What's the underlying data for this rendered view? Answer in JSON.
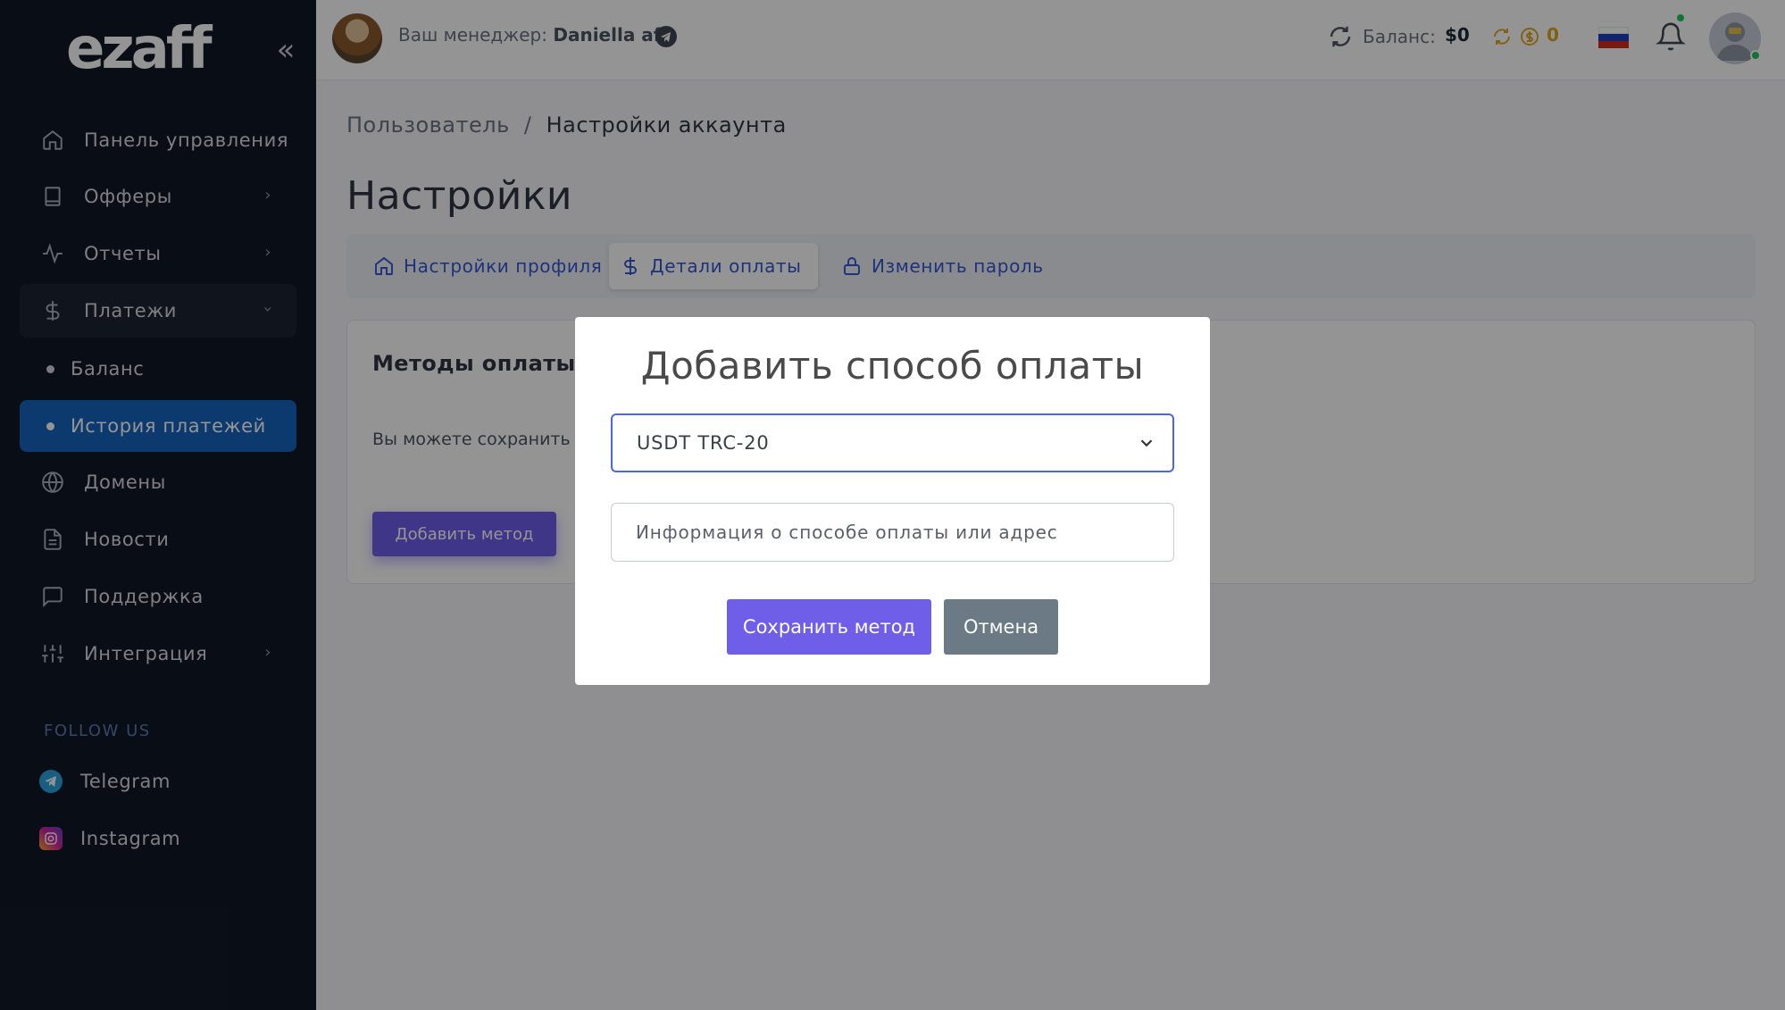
{
  "brand": {
    "logo_text": "ezaff"
  },
  "sidebar": {
    "items": [
      {
        "label": "Панель управления",
        "icon": "home-icon"
      },
      {
        "label": "Офферы",
        "icon": "book-icon"
      },
      {
        "label": "Отчеты",
        "icon": "activity-icon"
      },
      {
        "label": "Платежи",
        "icon": "dollar-icon"
      },
      {
        "label": "Домены",
        "icon": "globe-icon"
      },
      {
        "label": "Новости",
        "icon": "file-text-icon"
      },
      {
        "label": "Поддержка",
        "icon": "message-square-icon"
      },
      {
        "label": "Интеграция",
        "icon": "sliders-icon"
      }
    ],
    "sub_items": [
      {
        "label": "Баланс"
      },
      {
        "label": "История платежей"
      }
    ],
    "follow_label": "FOLLOW US",
    "social": [
      {
        "label": "Telegram",
        "icon": "telegram-icon",
        "color": "#2aa3e0"
      },
      {
        "label": "Instagram",
        "icon": "instagram-icon",
        "color": "#d6249f"
      }
    ]
  },
  "header": {
    "manager_label": "Ваш менеджер:",
    "manager_name": "Daniella aff",
    "balance_label": "Баланс:",
    "balance_value": "$0",
    "coins_value": "0"
  },
  "content": {
    "breadcrumb_parent": "Пользователь",
    "breadcrumb_sep": "/",
    "breadcrumb_current": "Настройки аккаунта",
    "page_title": "Настройки",
    "tabs": [
      {
        "label": "Настройки профиля",
        "icon": "home-icon"
      },
      {
        "label": "Детали оплаты",
        "icon": "dollar-icon"
      },
      {
        "label": "Изменить пароль",
        "icon": "lock-icon"
      }
    ],
    "card_title": "Методы оплаты",
    "card_text": "Вы можете сохранить п",
    "add_method_label": "Добавить метод"
  },
  "modal": {
    "title": "Добавить способ оплаты",
    "selected_method": "USDT TRC-20",
    "input_placeholder": "Информация о способе оплаты или адрес",
    "save_label": "Сохранить метод",
    "cancel_label": "Отмена"
  },
  "colors": {
    "sidebar_bg": "#111827",
    "active_item": "#1565c0",
    "primary_button": "#6e5ee8",
    "secondary_button": "#6c7a86",
    "link_blue": "#3457d5"
  }
}
